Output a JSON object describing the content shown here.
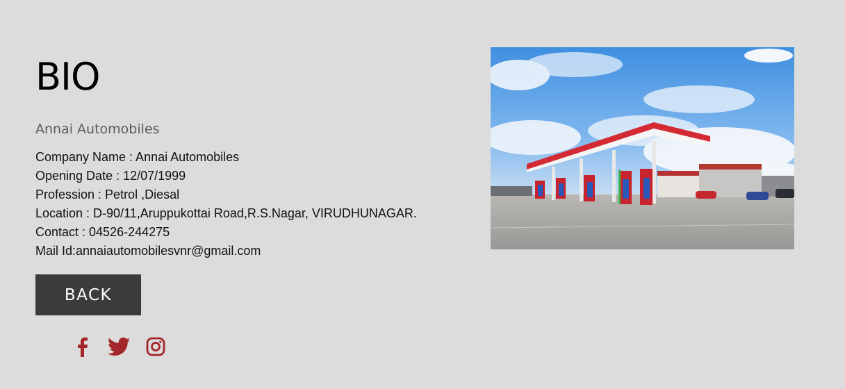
{
  "bio": {
    "title": "BIO",
    "subtitle": "Annai Automobiles",
    "details": [
      "Company Name : Annai Automobiles",
      "Opening Date : 12/07/1999",
      "Profession : Petrol ,Diesal",
      "Location : D-90/11,Aruppukottai Road,R.S.Nagar, VIRUDHUNAGAR.",
      "Contact : 04526-244275",
      "Mail Id:annaiautomobilesvnr@gmail.com"
    ]
  },
  "back_button": {
    "label": "BACK"
  },
  "social": [
    "facebook-icon",
    "twitter-icon",
    "instagram-icon"
  ],
  "colors": {
    "background": "#dddcdc",
    "button": "#3b3b3b",
    "social_icon": "#a3262a"
  }
}
